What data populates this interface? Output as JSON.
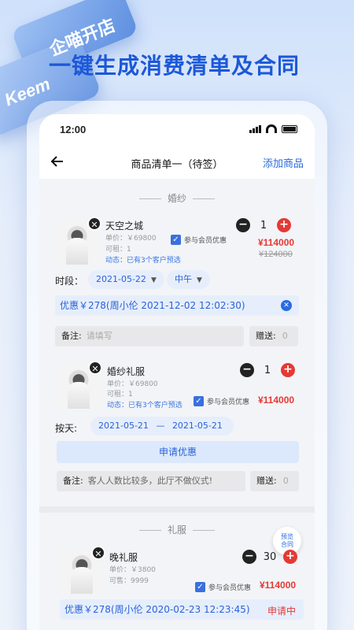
{
  "promo": {
    "headline": "一键生成消费清单及合同",
    "deco_text_1": "企喵开店",
    "deco_text_2": "Keem"
  },
  "status_bar": {
    "time": "12:00"
  },
  "nav": {
    "back_icon": "back-arrow-icon",
    "title": "商品清单一（待签）",
    "add_label": "添加商品"
  },
  "sections": [
    {
      "title": "婚纱",
      "items": [
        {
          "name": "天空之城",
          "unit_price": "单价：￥69800",
          "rentable": "可租：1",
          "activity": "动态：已有3个客户预选",
          "member_label": "参与会员优惠",
          "qty": "1",
          "price": "¥114000",
          "old_price": "¥124000",
          "period_label": "时段：",
          "date": "2021-05-22",
          "slot": "中午",
          "promo": "优惠￥278(周小伦 2021-12-02 12:02:30)",
          "note_label": "备注:",
          "note_placeholder": "请填写",
          "gift_label": "赠送:",
          "gift_value": "0"
        },
        {
          "name": "婚纱礼服",
          "unit_price": "单价：￥69800",
          "rentable": "可租：1",
          "activity": "动态：已有3个客户预选",
          "member_label": "参与会员优惠",
          "qty": "1",
          "price": "¥114000",
          "period_label": "按天:",
          "date_from": "2021-05-21",
          "date_sep": "—",
          "date_to": "2021-05-21",
          "apply_label": "申请优惠",
          "note_label": "备注:",
          "note_value": "客人人数比较多，此厅不做仪式!",
          "gift_label": "赠送:",
          "gift_value": "0"
        }
      ]
    },
    {
      "title": "礼服",
      "preview_label_1": "预览",
      "preview_label_2": "合同",
      "items": [
        {
          "name": "晚礼服",
          "unit_price": "单价：￥3800",
          "stock": "可售：9999",
          "member_label": "参与会员优惠",
          "qty": "30",
          "price": "¥114000",
          "promo": "优惠￥278(周小伦 2020-02-23 12:23:45)",
          "promo_status": "申请中"
        }
      ]
    }
  ],
  "colors": {
    "accent": "#2a6be0",
    "price_red": "#e53935",
    "headline_blue": "#1c58d8"
  }
}
